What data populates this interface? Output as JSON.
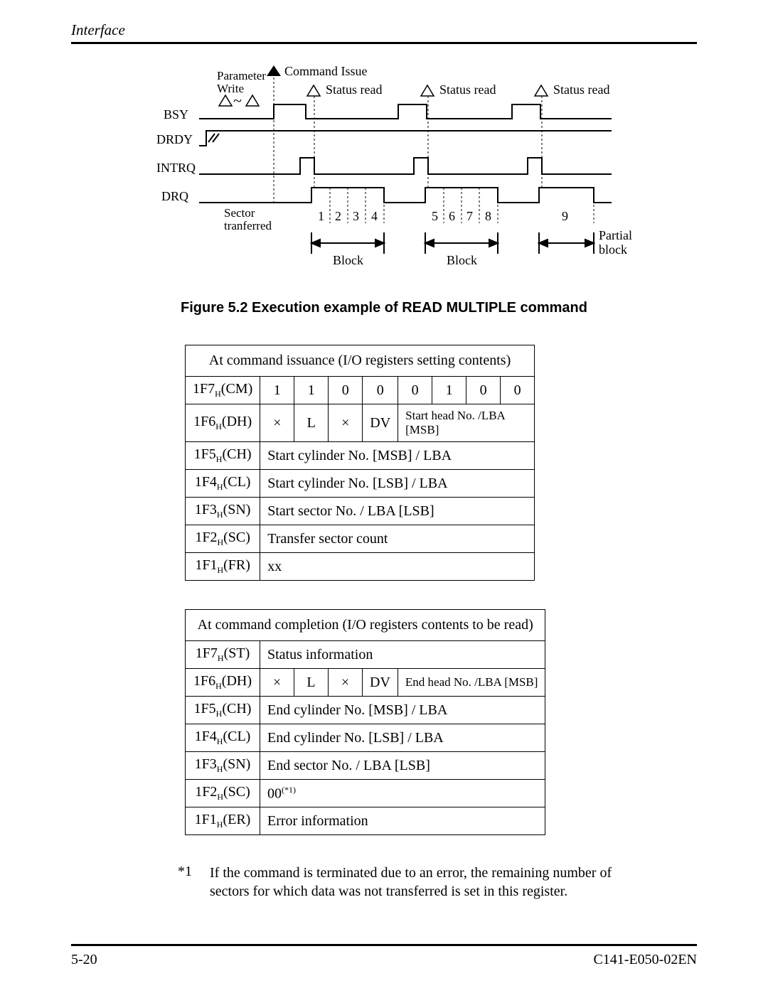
{
  "header": {
    "title": "Interface"
  },
  "diagram": {
    "labels": {
      "parameter_write": "Parameter\nWrite",
      "command_issue": "Command Issue",
      "status_read_1": "Status read",
      "status_read_2": "Status read",
      "status_read_3": "Status read",
      "bsy": "BSY",
      "drdy": "DRDY",
      "intrq": "INTRQ",
      "drq": "DRQ",
      "sector_transferred": "Sector\ntranferred",
      "block_1": "Block",
      "block_2": "Block",
      "partial_block": "Partial\nblock",
      "ticks": [
        "1",
        "2",
        "3",
        "4",
        "5",
        "6",
        "7",
        "8",
        "9"
      ]
    }
  },
  "figure_caption": "Figure 5.2  Execution example of READ MULTIPLE command",
  "table1": {
    "title": "At command issuance (I/O registers setting contents)",
    "rows": [
      {
        "label_html": "1F7<sub>H</sub>(CM)",
        "bits": [
          "1",
          "1",
          "0",
          "0",
          "0",
          "1",
          "0",
          "0"
        ]
      },
      {
        "label_html": "1F6<sub>H</sub>(DH)",
        "bits4": [
          "×",
          "L",
          "×",
          "DV"
        ],
        "span4": "Start head No. /LBA [MSB]"
      },
      {
        "label_html": "1F5<sub>H</sub>(CH)",
        "full": "Start cylinder No. [MSB] / LBA"
      },
      {
        "label_html": "1F4<sub>H</sub>(CL)",
        "full": "Start cylinder No. [LSB] / LBA"
      },
      {
        "label_html": "1F3<sub>H</sub>(SN)",
        "full": "Start sector No. / LBA [LSB]"
      },
      {
        "label_html": "1F2<sub>H</sub>(SC)",
        "full": "Transfer sector count"
      },
      {
        "label_html": "1F1<sub>H</sub>(FR)",
        "full": "xx"
      }
    ]
  },
  "table2": {
    "title": "At command completion (I/O registers contents to be read)",
    "rows": [
      {
        "label_html": "1F7<sub>H</sub>(ST)",
        "full": "Status information"
      },
      {
        "label_html": "1F6<sub>H</sub>(DH)",
        "bits4": [
          "×",
          "L",
          "×",
          "DV"
        ],
        "span4": "End head No. /LBA [MSB]"
      },
      {
        "label_html": "1F5<sub>H</sub>(CH)",
        "full": "End cylinder No. [MSB] / LBA"
      },
      {
        "label_html": "1F4<sub>H</sub>(CL)",
        "full": "End cylinder No. [LSB] / LBA"
      },
      {
        "label_html": "1F3<sub>H</sub>(SN)",
        "full": "End sector No. / LBA [LSB]"
      },
      {
        "label_html": "1F2<sub>H</sub>(SC)",
        "full_html": "00<sup>(*1)</sup>"
      },
      {
        "label_html": "1F1<sub>H</sub>(ER)",
        "full": "Error information"
      }
    ]
  },
  "note": {
    "label": "*1",
    "text": "If the command is terminated due to an error, the remaining number of sectors for which data was not transferred is set in this register."
  },
  "footer": {
    "page": "5-20",
    "doc": "C141-E050-02EN"
  }
}
